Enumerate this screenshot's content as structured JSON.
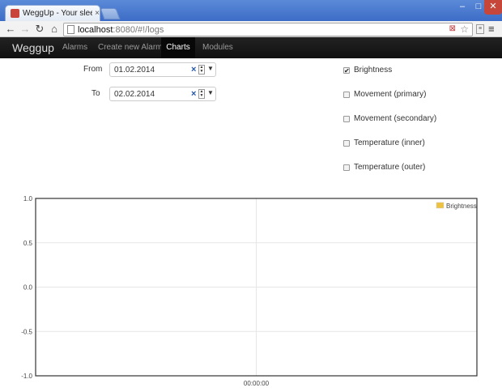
{
  "browser": {
    "tab_title": "WeggUp - Your sleep supp",
    "tab_close": "×",
    "url_host": "localhost",
    "url_rest": ":8080/#!/logs",
    "window_min": "–",
    "window_max": "□",
    "window_close": "✕",
    "icons": {
      "back": "back-arrow-icon",
      "forward": "forward-arrow-icon",
      "reload": "reload-icon",
      "home": "home-icon",
      "star": "star-icon",
      "menu": "menu-icon"
    }
  },
  "navbar": {
    "brand": "Weggup",
    "items": [
      {
        "label": "Alarms"
      },
      {
        "label": "Create new Alarm"
      },
      {
        "label": "Charts",
        "active": true
      },
      {
        "label": "Modules"
      }
    ]
  },
  "form": {
    "from_label": "From",
    "from_value": "01.02.2014",
    "to_label": "To",
    "to_value": "02.02.2014"
  },
  "series_toggles": [
    {
      "label": "Brightness",
      "checked": true
    },
    {
      "label": "Movement (primary)",
      "checked": false
    },
    {
      "label": "Movement (secondary)",
      "checked": false
    },
    {
      "label": "Temperature (inner)",
      "checked": false
    },
    {
      "label": "Temperature (outer)",
      "checked": false
    }
  ],
  "chart_data": {
    "type": "line",
    "title": "",
    "xlabel": "",
    "ylabel": "",
    "ylim": [
      -1.0,
      1.0
    ],
    "yticks": [
      "1.0",
      "0.5",
      "0.0",
      "-0.5",
      "-1.0"
    ],
    "xticks": [
      "00:00:00"
    ],
    "grid": true,
    "legend_position": "top-right",
    "series": [
      {
        "name": "Brightness",
        "color": "#edc240",
        "x": [],
        "y": []
      }
    ]
  },
  "colors": {
    "navbar_bg": "#1b1b1b",
    "legend_brightness": "#edc240"
  }
}
